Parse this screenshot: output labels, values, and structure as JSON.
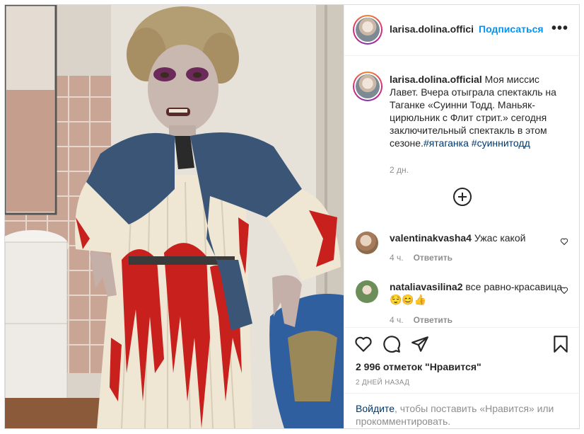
{
  "post": {
    "username": "larisa.dolina.offici",
    "follow_label": "Подписаться",
    "more_label": "•••"
  },
  "caption": {
    "username": "larisa.dolina.official",
    "text": " Моя миссис Лавет. Вчера отыграла спектакль на Таганке «Суинни Тодд. Маньяк-цирюльник с Флит стрит.» сегодня заключительный спектакль в этом сезоне.",
    "hashtag1": "#ятаганка",
    "hashtag2": "#суиннитодд",
    "time": "2 дн."
  },
  "comments": [
    {
      "username": "valentinakvasha4",
      "text": " Ужас какой",
      "time": "4 ч.",
      "reply_label": "Ответить"
    },
    {
      "username": "nataliavasilina2",
      "text": " все равно-красавица😌😊👍",
      "time": "4 ч.",
      "reply_label": "Ответить"
    }
  ],
  "actions": {
    "icons": [
      "heart-icon",
      "comment-icon",
      "share-icon",
      "bookmark-icon"
    ],
    "likes": "2 996 отметок \"Нравится\"",
    "date": "2 ДНЕЙ НАЗАД"
  },
  "login": {
    "link": "Войдите",
    "text": ", чтобы поставить «Нравится» или прокомментировать."
  },
  "colors": {
    "link_blue": "#0095f6",
    "hashtag": "#00376b",
    "muted": "#8e8e8e",
    "blood": "#c8201d",
    "jacket": "#3a5576"
  }
}
